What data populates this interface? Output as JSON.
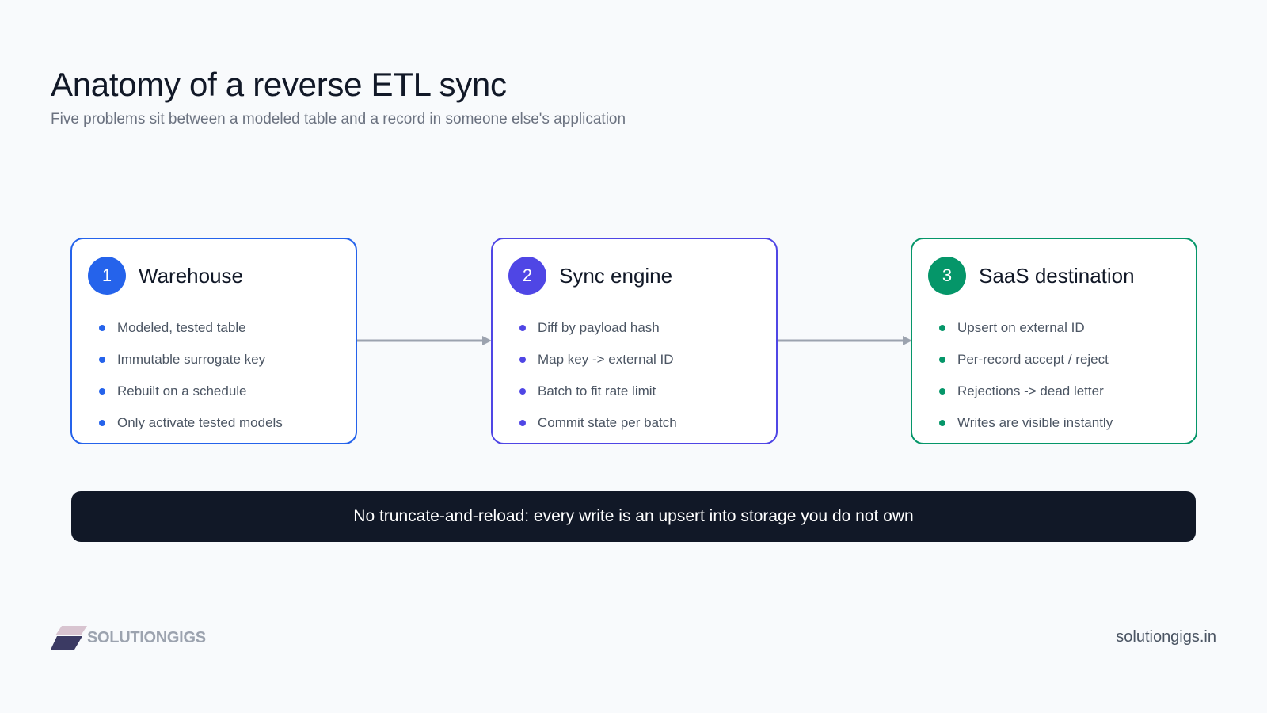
{
  "header": {
    "title": "Anatomy of a reverse ETL sync",
    "subtitle": "Five problems sit between a modeled table and a record in someone else's application"
  },
  "cards": [
    {
      "number": "1",
      "title": "Warehouse",
      "color": "#2563eb",
      "bullets": [
        "Modeled, tested table",
        "Immutable surrogate key",
        "Rebuilt on a schedule",
        "Only activate tested models"
      ]
    },
    {
      "number": "2",
      "title": "Sync engine",
      "color": "#4f46e5",
      "bullets": [
        "Diff by payload hash",
        "Map key -> external ID",
        "Batch to fit rate limit",
        "Commit state per batch"
      ]
    },
    {
      "number": "3",
      "title": "SaaS destination",
      "color": "#059669",
      "bullets": [
        "Upsert on external ID",
        "Per-record accept / reject",
        "Rejections -> dead letter",
        "Writes are visible instantly"
      ]
    }
  ],
  "connector_color": "#9ca3af",
  "banner": {
    "text": "No truncate-and-reload: every write is an upsert into storage you do not own"
  },
  "footer": {
    "logo_text": "SOLUTIONGIGS",
    "site": "solutiongigs.in"
  }
}
